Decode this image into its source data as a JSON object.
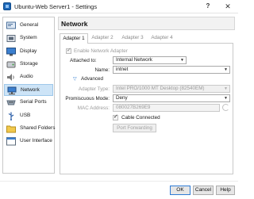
{
  "window": {
    "title": "Ubuntu-Web Server1 - Settings",
    "help_label": "?",
    "close_label": "✕"
  },
  "sidebar": {
    "items": [
      {
        "label": "General",
        "icon": "general-icon"
      },
      {
        "label": "System",
        "icon": "system-icon"
      },
      {
        "label": "Display",
        "icon": "display-icon"
      },
      {
        "label": "Storage",
        "icon": "storage-icon"
      },
      {
        "label": "Audio",
        "icon": "audio-icon"
      },
      {
        "label": "Network",
        "icon": "network-icon",
        "active": true
      },
      {
        "label": "Serial Ports",
        "icon": "serial-ports-icon"
      },
      {
        "label": "USB",
        "icon": "usb-icon"
      },
      {
        "label": "Shared Folders",
        "icon": "shared-folders-icon"
      },
      {
        "label": "User Interface",
        "icon": "user-interface-icon"
      }
    ]
  },
  "page": {
    "title": "Network"
  },
  "tabs": [
    {
      "label": "Adapter 1",
      "active": true
    },
    {
      "label": "Adapter 2"
    },
    {
      "label": "Adapter 3"
    },
    {
      "label": "Adapter 4"
    }
  ],
  "adapter": {
    "enable_label": "Enable Network Adapter",
    "attached_label": "Attached to:",
    "attached_value": "Internal Network",
    "name_label": "Name:",
    "name_value": "intnet",
    "advanced_label": "Advanced",
    "adapter_type_label": "Adapter Type:",
    "adapter_type_value": "Intel PRO/1000 MT Desktop (82540EM)",
    "promiscuous_label": "Promiscuous Mode:",
    "promiscuous_value": "Deny",
    "mac_label": "MAC Address:",
    "mac_value": "080027B269E9",
    "cable_label": "Cable Connected",
    "port_forwarding_label": "Port Forwarding"
  },
  "buttons": {
    "ok": "OK",
    "cancel": "Cancel",
    "help": "Help"
  },
  "colors": {
    "accent": "#2f7bd5",
    "selection": "#cde4f7"
  }
}
